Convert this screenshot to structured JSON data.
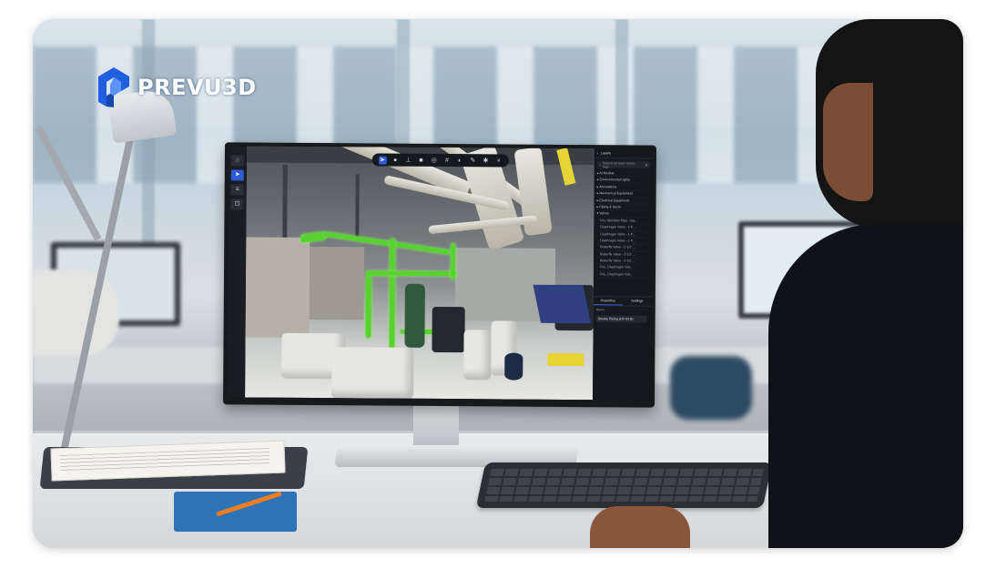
{
  "brand": {
    "name_part1": "PREVU",
    "name_part2": "3D",
    "logo_color": "#1f5fe0"
  },
  "viewer": {
    "panel_title": "Layers",
    "search_placeholder": "Search by layer name, tags...",
    "layers": [
      {
        "label": "AI Models",
        "level": 0
      },
      {
        "label": "Environmental Lights",
        "level": 0
      },
      {
        "label": "Annotations",
        "level": 0
      },
      {
        "label": "Mechanical Equipment",
        "level": 0
      },
      {
        "label": "Electrical Equipment",
        "level": 0
      },
      {
        "label": "Piping & Ducts",
        "level": 0
      },
      {
        "label": "Valves",
        "level": 0
      },
      {
        "label": "Fire Sprinkler Pipe - Ele...",
        "level": 1
      },
      {
        "label": "Diaphragm Valve - 1 F...",
        "level": 1
      },
      {
        "label": "Diaphragm Valve - 1 F...",
        "level": 1
      },
      {
        "label": "Diaphragm Valve - 1 F...",
        "level": 1
      },
      {
        "label": "Butterfly Valve - 2-1/2 ...",
        "level": 1
      },
      {
        "label": "Butterfly Valve - 2-1/2 ...",
        "level": 1
      },
      {
        "label": "Butterfly Valve - 2-1/2 ...",
        "level": 1
      },
      {
        "label": "Fire_Diaphragm Valv...",
        "level": 1
      },
      {
        "label": "Fire_Diaphragm Valv...",
        "level": 1
      }
    ],
    "tabs": [
      "Properties",
      "Settings"
    ],
    "property_label": "Name",
    "property_value": "Smoke Piping (HV 03 B)",
    "accent_color": "#2f5bd6",
    "pipe_highlight_color": "#57d22f"
  },
  "icons": {
    "left_tools": [
      "home-icon",
      "cursor-icon",
      "layers-icon",
      "measure-icon"
    ],
    "top_toolbar": [
      "cursor-icon",
      "pin-icon",
      "measure-icon",
      "cube-icon",
      "target-icon",
      "grid-icon",
      "camera-icon",
      "pen-icon",
      "settings-icon",
      "close-icon"
    ]
  }
}
